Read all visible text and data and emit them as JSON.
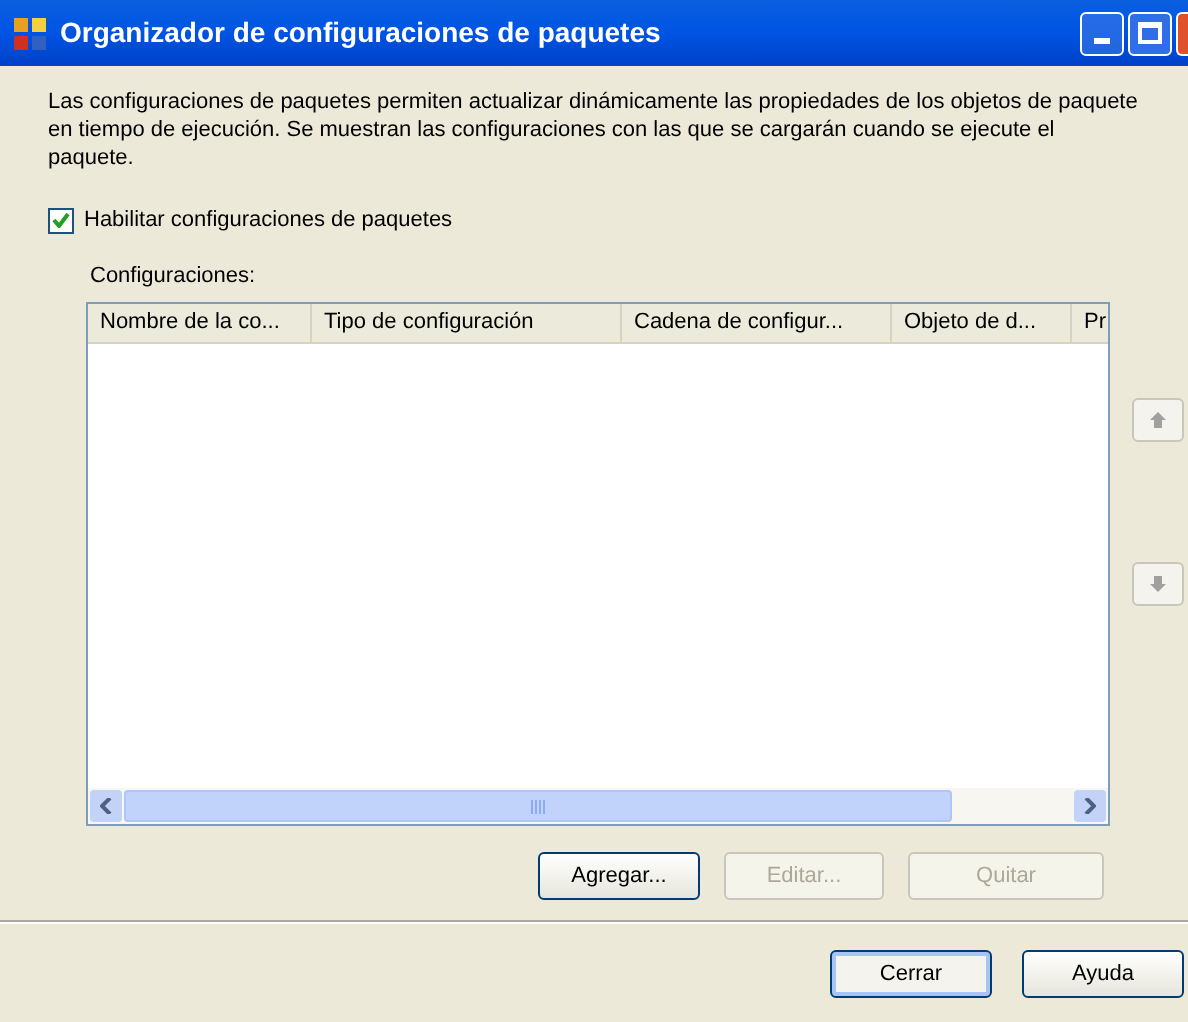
{
  "window": {
    "title": "Organizador de configuraciones de paquetes"
  },
  "description": "Las configuraciones de paquetes permiten actualizar dinámicamente las propiedades de los objetos de paquete en tiempo de ejecución. Se muestran las configuraciones con las que se cargarán cuando se ejecute el paquete.",
  "enable_checkbox": {
    "label": "Habilitar configuraciones de paquetes",
    "checked": true
  },
  "list": {
    "label": "Configuraciones:",
    "columns": [
      "Nombre de la co...",
      "Tipo de configuración",
      "Cadena de configur...",
      "Objeto de d...",
      "Pr"
    ]
  },
  "list_buttons": [
    {
      "label": "Agregar...",
      "disabled": false
    },
    {
      "label": "Editar...",
      "disabled": true
    },
    {
      "label": "Quitar",
      "disabled": true
    }
  ],
  "dialog_buttons": [
    {
      "label": "Cerrar",
      "default": true
    },
    {
      "label": "Ayuda",
      "default": false
    }
  ]
}
